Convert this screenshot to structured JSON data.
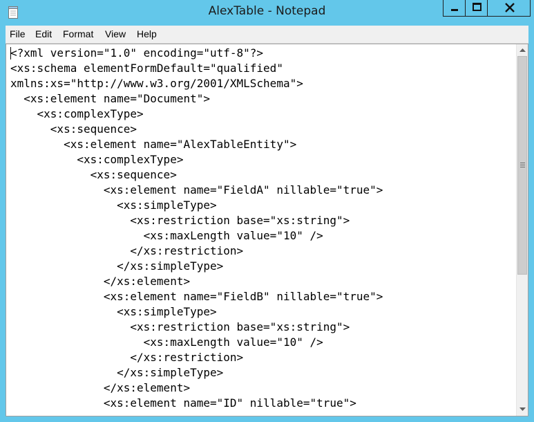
{
  "window": {
    "title": "AlexTable - Notepad",
    "icon": "notepad-icon",
    "controls": [
      "minimize-icon",
      "maximize-icon",
      "close-icon"
    ]
  },
  "menu": {
    "items": [
      "File",
      "Edit",
      "Format",
      "View",
      "Help"
    ]
  },
  "editor": {
    "lines": [
      "<?xml version=\"1.0\" encoding=\"utf-8\"?>",
      "<xs:schema elementFormDefault=\"qualified\"",
      "xmlns:xs=\"http://www.w3.org/2001/XMLSchema\">",
      "  <xs:element name=\"Document\">",
      "    <xs:complexType>",
      "      <xs:sequence>",
      "        <xs:element name=\"AlexTableEntity\">",
      "          <xs:complexType>",
      "            <xs:sequence>",
      "              <xs:element name=\"FieldA\" nillable=\"true\">",
      "                <xs:simpleType>",
      "                  <xs:restriction base=\"xs:string\">",
      "                    <xs:maxLength value=\"10\" />",
      "                  </xs:restriction>",
      "                </xs:simpleType>",
      "              </xs:element>",
      "              <xs:element name=\"FieldB\" nillable=\"true\">",
      "                <xs:simpleType>",
      "                  <xs:restriction base=\"xs:string\">",
      "                    <xs:maxLength value=\"10\" />",
      "                  </xs:restriction>",
      "                </xs:simpleType>",
      "              </xs:element>",
      "              <xs:element name=\"ID\" nillable=\"true\">"
    ]
  },
  "scrollbar": {
    "position": 0.0,
    "up_icon": "arrow-up-icon",
    "down_icon": "arrow-down-icon"
  }
}
